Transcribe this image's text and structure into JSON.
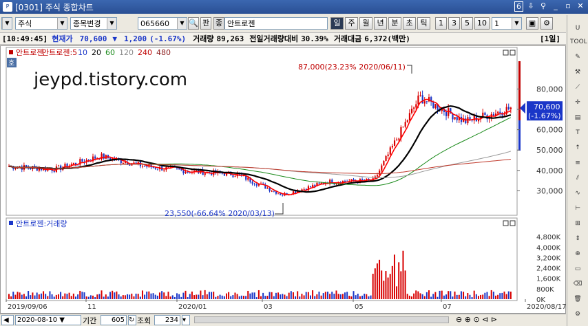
{
  "window": {
    "title": "[0301] 주식 종합차트",
    "app_icon": "P",
    "badge_num": "6",
    "controls": [
      "pin-icon",
      "gear-icon",
      "minimize-icon",
      "restore-icon",
      "close-icon"
    ],
    "control_glyphs": [
      "⇩",
      "⚲",
      "_",
      "▫",
      "✕"
    ]
  },
  "toolbar": {
    "market_select": "주식",
    "stock_change": "종목변경",
    "code_input": "065660",
    "pan_label": "판",
    "mode_badge": "종",
    "stock_name": "안트로젠",
    "periods": [
      "일",
      "주",
      "월",
      "년",
      "분",
      "초",
      "틱"
    ],
    "active_period": "일",
    "numbers": [
      "1",
      "3",
      "5",
      "10"
    ],
    "interval_value": "1"
  },
  "info": {
    "time": "[10:49:45]",
    "price_label": "현재가",
    "price": "70,600",
    "change_arrow": "▼",
    "change": "1,200",
    "change_pct": "(-1.67%)",
    "volume_label": "거래량",
    "volume": "89,263",
    "prev_ratio_label": "전일거래량대비",
    "prev_ratio": "30.39%",
    "amount_label": "거래대금",
    "amount": "6,372(백만)",
    "period_badge": "[1일]"
  },
  "price_panel": {
    "legend": [
      {
        "text": "안트로젠",
        "color": "#c00000"
      },
      {
        "text": "안트로젠:5",
        "color": "#c00000"
      },
      {
        "text": "10",
        "color": "#1a36c8"
      },
      {
        "text": "20",
        "color": "#000000"
      },
      {
        "text": "60",
        "color": "#1a8a1a"
      },
      {
        "text": "120",
        "color": "#888888"
      },
      {
        "text": "240",
        "color": "#c00000"
      },
      {
        "text": "480",
        "color": "#8b1a1a"
      }
    ],
    "hoga_badge": "호",
    "watermark": "jeypd.tistory.com",
    "high_annotation": "87,000(23.23% 2020/06/11)",
    "low_annotation": "23,550(-66.64% 2020/03/13)",
    "y_ticks": [
      "80,000",
      "70,000",
      "60,000",
      "50,000",
      "40,000",
      "30,000"
    ],
    "current_price_tag": "70,600",
    "current_change_tag": "(-1.67%)"
  },
  "volume_panel": {
    "legend": "안트로젠:거래량",
    "y_ticks": [
      "4,800K",
      "4,000K",
      "3,200K",
      "2,400K",
      "1,600K",
      "800K",
      "0K"
    ]
  },
  "x_axis": {
    "labels": [
      "2019/09/06",
      "11",
      "2020/01",
      "03",
      "05",
      "07",
      "2020/08/17"
    ]
  },
  "bottom": {
    "date_value": "2020-08-10",
    "period_label": "기간",
    "period_value": "605",
    "lookup_label": "조회",
    "lookup_value": "234"
  },
  "colors": {
    "up": "#d80000",
    "down": "#1a36c8",
    "ma5": "#ff0000",
    "ma20": "#000000",
    "ma60": "#1a8a1a",
    "ma120": "#999999",
    "ma240": "#c0392b",
    "ma480": "#8b1a1a"
  },
  "chart_data": {
    "type": "candlestick",
    "title": "",
    "x": [
      "2019/09",
      "2019/10",
      "2019/11",
      "2019/12",
      "2020/01",
      "2020/02",
      "2020/03",
      "2020/04",
      "2020/05",
      "2020/06",
      "2020/07",
      "2020/08"
    ],
    "close": [
      42000,
      40500,
      47000,
      42000,
      39500,
      38000,
      28000,
      34500,
      35000,
      76000,
      64000,
      70600
    ],
    "ylim": [
      20000,
      95000
    ],
    "volume_ylim": [
      0,
      5600000
    ],
    "annotations": [
      {
        "text": "87,000(23.23% 2020/06/11)",
        "x": "2020/06/11",
        "y": 87000
      },
      {
        "text": "23,550(-66.64% 2020/03/13)",
        "x": "2020/03/13",
        "y": 23550
      }
    ],
    "grid": false,
    "legend": "top-left"
  }
}
